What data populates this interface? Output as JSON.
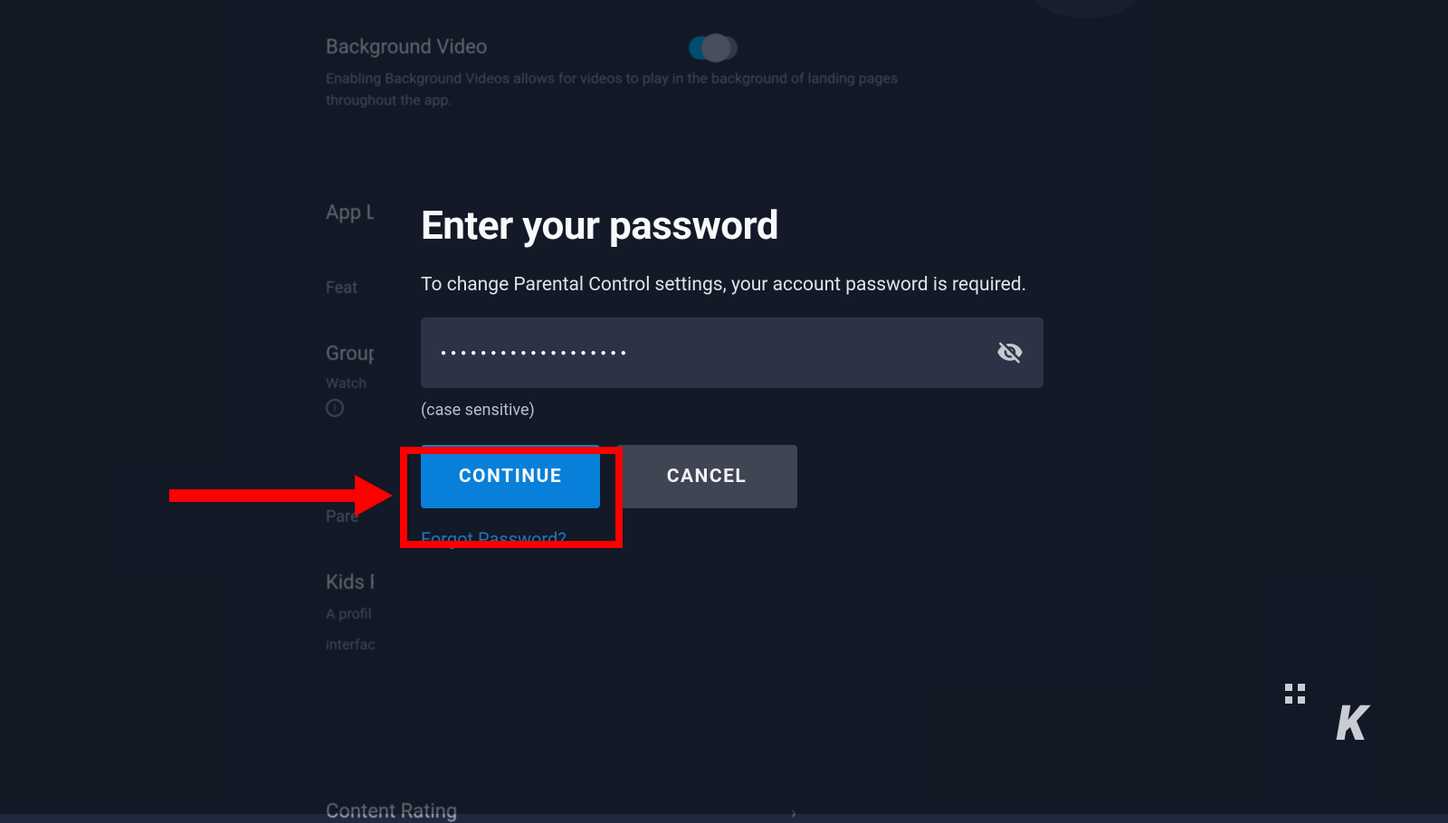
{
  "background": {
    "backgroundVideo": {
      "title": "Background Video",
      "desc": "Enabling Background Videos allows for videos to play in the background of landing pages throughout the app."
    },
    "appLabel": "App L",
    "feat": "Feat",
    "group": {
      "title": "Group",
      "watch": "Watch"
    },
    "paren": "Pare",
    "kids": {
      "title": "Kids P",
      "desc1": "A profil",
      "desc2": "interfac"
    },
    "contentRating": "Content Rating"
  },
  "modal": {
    "title": "Enter your password",
    "description": "To change Parental Control settings, your account password is required.",
    "passwordMask": "●●●●●●●●●●●●●●●●●●●",
    "caseSensitive": "(case sensitive)",
    "continueLabel": "CONTINUE",
    "cancelLabel": "CANCEL",
    "forgotLabel": "Forgot Password?"
  },
  "watermark": "K"
}
